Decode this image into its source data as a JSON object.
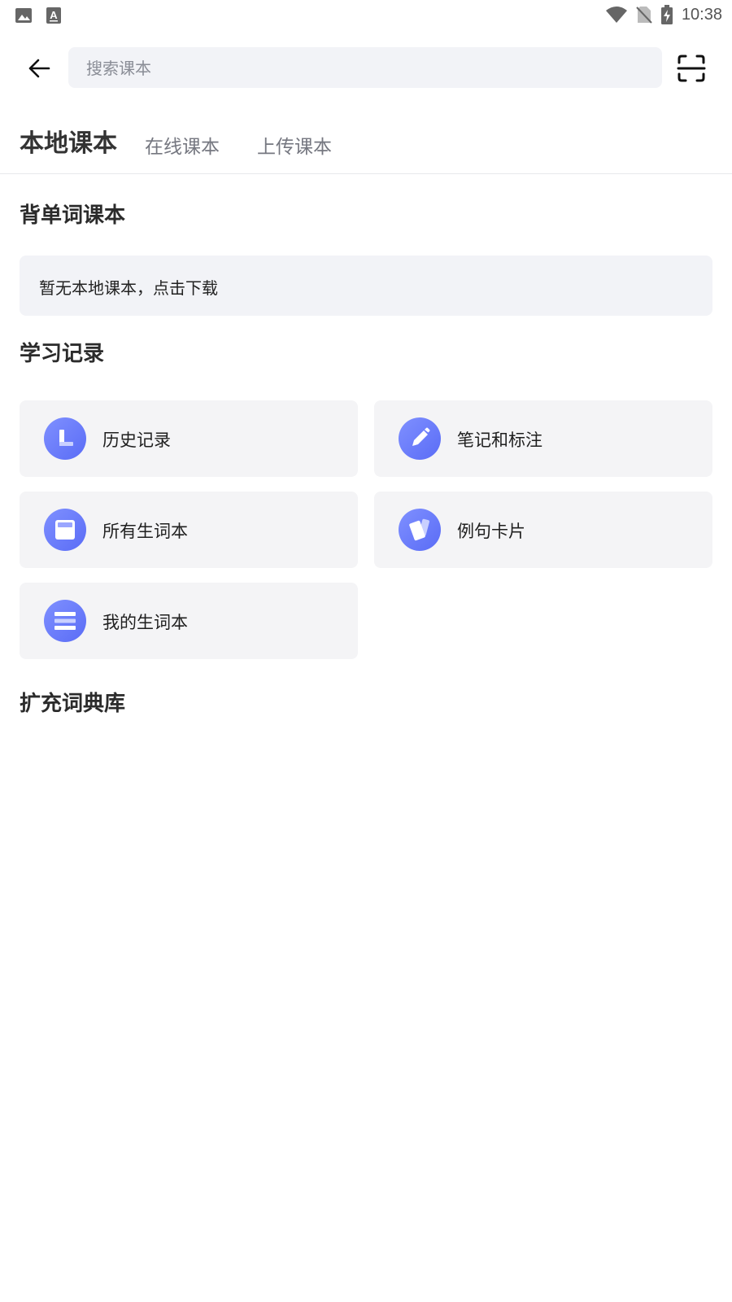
{
  "status_bar": {
    "time": "10:38",
    "left_icons": [
      "image-icon",
      "font-a-icon"
    ],
    "right_icons": [
      "wifi-icon",
      "no-sim-icon",
      "battery-charging-icon"
    ]
  },
  "search": {
    "placeholder": "搜索课本",
    "value": ""
  },
  "tabs": [
    {
      "label": "本地课本",
      "active": true
    },
    {
      "label": "在线课本",
      "active": false
    },
    {
      "label": "上传课本",
      "active": false
    }
  ],
  "sections": {
    "word_books": {
      "title": "背单词课本",
      "empty_text": "暂无本地课本，点击下载"
    },
    "study_records": {
      "title": "学习记录",
      "items": [
        {
          "label": "历史记录",
          "icon": "history-icon"
        },
        {
          "label": "笔记和标注",
          "icon": "pencil-icon"
        },
        {
          "label": "所有生词本",
          "icon": "notebook-icon"
        },
        {
          "label": "例句卡片",
          "icon": "cards-icon"
        },
        {
          "label": "我的生词本",
          "icon": "list-icon"
        }
      ]
    },
    "dictionaries": {
      "title": "扩充词典库"
    }
  },
  "colors": {
    "accent_gradient_start": "#7f90ff",
    "accent_gradient_end": "#5a6cf6",
    "card_bg": "#f4f4f6",
    "search_bg": "#f2f3f7"
  }
}
